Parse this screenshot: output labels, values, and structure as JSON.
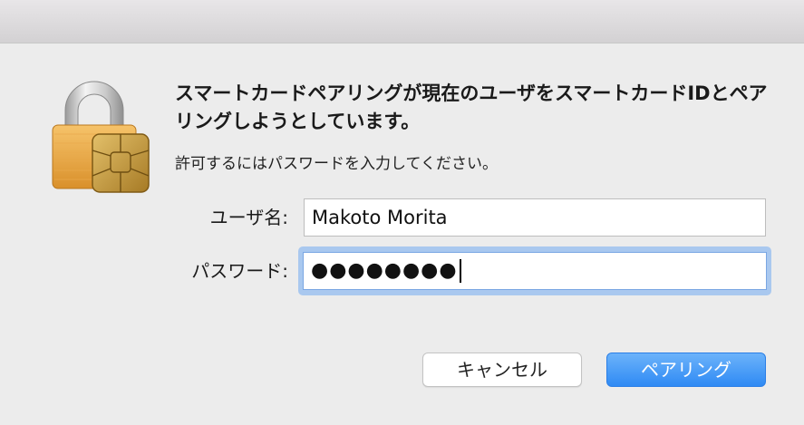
{
  "dialog": {
    "heading": "スマートカードペアリングが現在のユーザをスマートカードIDとペアリングしようとしています。",
    "instruction": "許可するにはパスワードを入力してください。",
    "icon": "smartcard-lock-icon"
  },
  "form": {
    "username_label": "ユーザ名:",
    "username_value": "Makoto Morita",
    "password_label": "パスワード:",
    "password_masked": "●●●●●●●●"
  },
  "buttons": {
    "cancel_label": "キャンセル",
    "pair_label": "ペアリング"
  },
  "colors": {
    "accent": "#3c92f6",
    "focus_ring": "#a9c8ef"
  }
}
